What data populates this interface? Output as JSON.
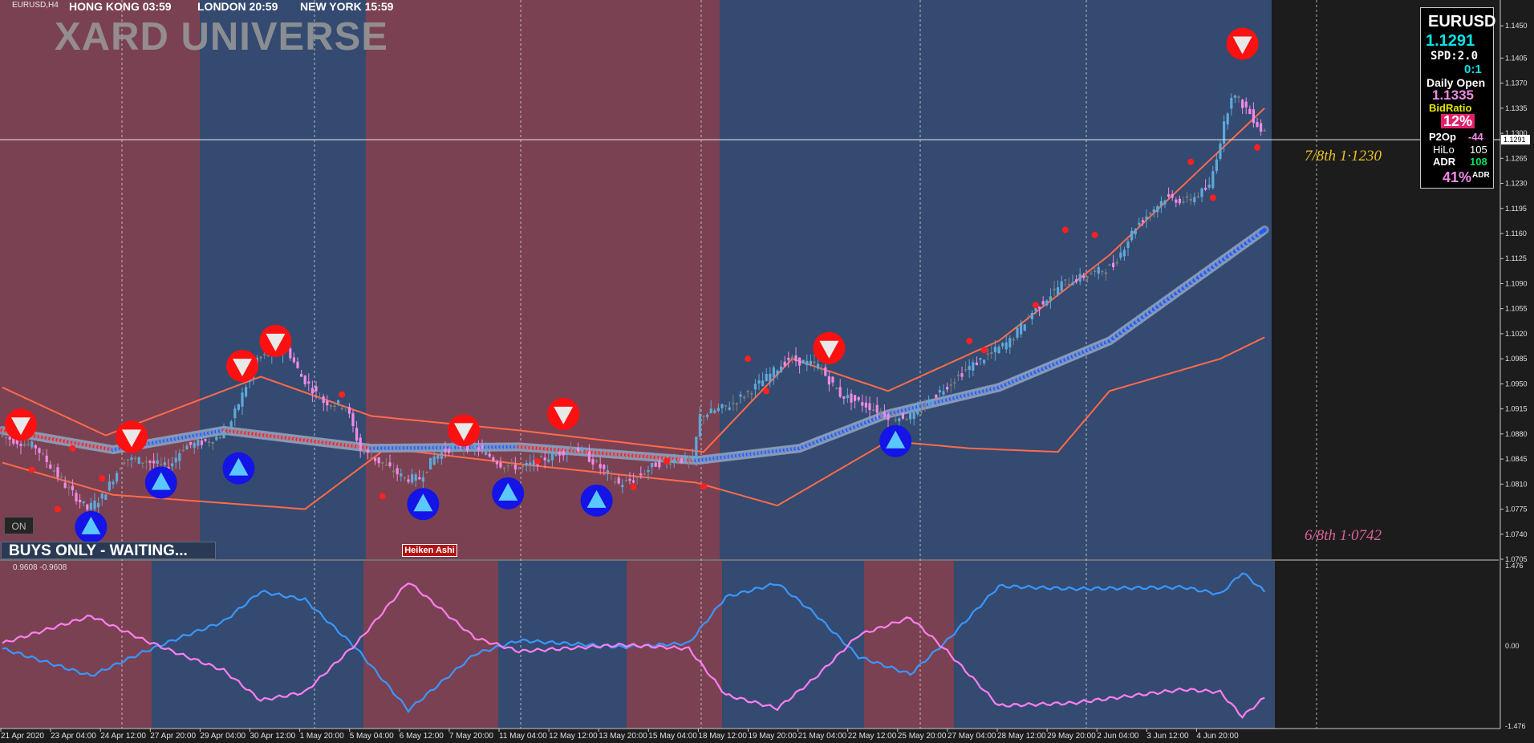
{
  "symbol_title": "EURUSD,H4",
  "logo_text": "XARD UNIVERSE",
  "sessions": [
    {
      "label": "HONG KONG 03:59",
      "color": "#9e1a1a"
    },
    {
      "label": "LONDON 20:59",
      "color": "#9e1a1a"
    },
    {
      "label": "NEW YORK 15:59",
      "color": "#1f6fd6"
    }
  ],
  "info_panel": {
    "symbol": "EURUSD",
    "price": "1.1291",
    "spread": "SPD:2.0",
    "ratio": "0:1",
    "daily_open_label": "Daily Open",
    "daily_open": "1.1335",
    "bid_ratio_label": "BidRatio",
    "bid_ratio": "12%",
    "p2op_label": "P2Op",
    "p2op": "-44",
    "hilo_label": "HiLo",
    "hilo": "105",
    "adr_label": "ADR",
    "adr": "108",
    "adr_pct": "41%",
    "adr_pct_label": "ADR"
  },
  "levels": [
    {
      "label": "7/8th  1·1230",
      "color": "#e6c020"
    },
    {
      "label": "6/8th  1·0742",
      "color": "#e0609a"
    }
  ],
  "buttons": {
    "on_label": "ON",
    "heiken_label": "Heiken Ashi"
  },
  "status_text": "BUYS ONLY - WAITING...",
  "oscillator_label": "0.9608 -0.9608",
  "colors": {
    "bg": "#1c1c1c",
    "red_zone": "#7a4152",
    "blue_zone": "#344a70",
    "bull_candle": "#5fa8d8",
    "bear_candle": "#f08ae6",
    "neutral_candle": "#808080",
    "fast_ma_blue": "#1e5bff",
    "fast_ma_red": "#ff1a1a",
    "envelope": "#ff6a4a",
    "osc_blue": "#3a96ff",
    "osc_pink": "#ff7ef0"
  },
  "chart_data": [
    {
      "type": "candlestick",
      "symbol": "EURUSD",
      "timeframe": "H4",
      "current_price": 1.1291,
      "ylim": [
        1.0705,
        1.1485
      ],
      "y_ticks": [
        "1.1450",
        "1.1405",
        "1.1370",
        "1.1335",
        "1.1300",
        "1.1265",
        "1.1230",
        "1.1195",
        "1.1160",
        "1.1125",
        "1.1090",
        "1.1055",
        "1.1020",
        "1.0985",
        "1.0950",
        "1.0915",
        "1.0880",
        "1.0845",
        "1.0810",
        "1.0775",
        "1.0740",
        "1.0705"
      ],
      "x_ticks": [
        "21 Apr 2020",
        "23 Apr 04:00",
        "24 Apr 12:00",
        "27 Apr 20:00",
        "29 Apr 04:00",
        "30 Apr 12:00",
        "1 May 20:00",
        "5 May 04:00",
        "6 May 12:00",
        "7 May 20:00",
        "11 May 04:00",
        "12 May 12:00",
        "13 May 20:00",
        "15 May 04:00",
        "18 May 12:00",
        "19 May 20:00",
        "21 May 04:00",
        "22 May 12:00",
        "25 May 20:00",
        "27 May 04:00",
        "28 May 12:00",
        "29 May 20:00",
        "2 Jun 04:00",
        "3 Jun 12:00",
        "4 Jun 20:00"
      ],
      "price_path": [
        [
          0,
          1.0878
        ],
        [
          10,
          1.0862
        ],
        [
          18,
          1.0808
        ],
        [
          24,
          1.0775
        ],
        [
          28,
          1.0792
        ],
        [
          34,
          1.0845
        ],
        [
          40,
          1.0842
        ],
        [
          46,
          1.0833
        ],
        [
          50,
          1.0862
        ],
        [
          58,
          1.0872
        ],
        [
          62,
          1.0885
        ],
        [
          70,
          1.0985
        ],
        [
          78,
          1.1
        ],
        [
          82,
          1.096
        ],
        [
          88,
          1.0925
        ],
        [
          94,
          1.092
        ],
        [
          98,
          1.0858
        ],
        [
          104,
          1.0838
        ],
        [
          110,
          1.0818
        ],
        [
          114,
          1.0818
        ],
        [
          118,
          1.0848
        ],
        [
          124,
          1.0865
        ],
        [
          130,
          1.086
        ],
        [
          136,
          1.0838
        ],
        [
          142,
          1.0833
        ],
        [
          150,
          1.085
        ],
        [
          156,
          1.0862
        ],
        [
          162,
          1.0838
        ],
        [
          168,
          1.081
        ],
        [
          172,
          1.0816
        ],
        [
          178,
          1.0838
        ],
        [
          184,
          1.0845
        ],
        [
          188,
          1.0843
        ],
        [
          190,
          1.0905
        ],
        [
          198,
          1.092
        ],
        [
          206,
          1.095
        ],
        [
          214,
          1.0985
        ],
        [
          222,
          1.0975
        ],
        [
          228,
          1.0935
        ],
        [
          236,
          1.0918
        ],
        [
          242,
          1.0903
        ],
        [
          248,
          1.0905
        ],
        [
          254,
          1.0935
        ],
        [
          262,
          1.097
        ],
        [
          268,
          1.099
        ],
        [
          274,
          1.101
        ],
        [
          280,
          1.105
        ],
        [
          288,
          1.109
        ],
        [
          294,
          1.11
        ],
        [
          302,
          1.1115
        ],
        [
          308,
          1.117
        ],
        [
          316,
          1.121
        ],
        [
          322,
          1.1205
        ],
        [
          328,
          1.1225
        ],
        [
          334,
          1.1355
        ],
        [
          338,
          1.1335
        ],
        [
          342,
          1.1305
        ]
      ],
      "bands": [
        {
          "name": "",
          "points": [
            [
              0,
              1.0885
            ],
            [
              30,
              1.0858
            ],
            [
              60,
              1.0885
            ],
            [
              100,
              1.086
            ],
            [
              140,
              1.0862
            ],
            [
              188,
              1.0843
            ],
            [
              216,
              1.086
            ],
            [
              240,
              1.0908
            ],
            [
              270,
              1.0945
            ],
            [
              300,
              1.101
            ],
            [
              342,
              1.1165
            ]
          ]
        },
        {
          "name": "",
          "points": [
            [
              0,
              1.0945
            ],
            [
              28,
              1.0878
            ],
            [
              70,
              1.096
            ],
            [
              100,
              1.0905
            ],
            [
              140,
              1.0885
            ],
            [
              190,
              1.0855
            ],
            [
              214,
              1.0985
            ],
            [
              240,
              1.094
            ],
            [
              270,
              1.101
            ],
            [
              300,
              1.113
            ],
            [
              342,
              1.1335
            ]
          ]
        },
        {
          "name": "",
          "points": [
            [
              0,
              1.084
            ],
            [
              30,
              1.0795
            ],
            [
              82,
              1.0775
            ],
            [
              104,
              1.086
            ],
            [
              140,
              1.0838
            ],
            [
              188,
              1.0812
            ],
            [
              210,
              1.078
            ],
            [
              240,
              1.087
            ],
            [
              262,
              1.086
            ],
            [
              286,
              1.0855
            ],
            [
              300,
              1.094
            ],
            [
              330,
              1.0985
            ],
            [
              342,
              1.1015
            ]
          ]
        }
      ]
    },
    {
      "type": "line",
      "title": "0.9608 -0.9608",
      "ylim": [
        -1.476,
        1.476
      ],
      "y_ticks": [
        "1.476",
        "0.00",
        "-1.476"
      ],
      "series": [
        {
          "points": [
            [
              0,
              -0.05
            ],
            [
              24,
              -0.55
            ],
            [
              38,
              -0.12
            ],
            [
              48,
              0.15
            ],
            [
              60,
              0.45
            ],
            [
              70,
              1.0
            ],
            [
              82,
              0.85
            ],
            [
              96,
              -0.05
            ],
            [
              110,
              -1.18
            ],
            [
              128,
              -0.15
            ],
            [
              140,
              0.1
            ],
            [
              168,
              -0.02
            ],
            [
              186,
              0.05
            ],
            [
              196,
              0.9
            ],
            [
              210,
              1.15
            ],
            [
              220,
              0.6
            ],
            [
              232,
              -0.2
            ],
            [
              246,
              -0.52
            ],
            [
              256,
              0.1
            ],
            [
              270,
              1.1
            ],
            [
              290,
              1.05
            ],
            [
              320,
              1.08
            ],
            [
              330,
              0.95
            ],
            [
              336,
              1.35
            ],
            [
              342,
              1.0
            ]
          ]
        },
        {
          "points": [
            [
              0,
              0.05
            ],
            [
              24,
              0.55
            ],
            [
              38,
              0.12
            ],
            [
              48,
              -0.15
            ],
            [
              60,
              -0.45
            ],
            [
              70,
              -1.0
            ],
            [
              82,
              -0.85
            ],
            [
              96,
              0.05
            ],
            [
              110,
              1.18
            ],
            [
              128,
              0.15
            ],
            [
              140,
              -0.1
            ],
            [
              168,
              0.02
            ],
            [
              186,
              -0.05
            ],
            [
              196,
              -0.9
            ],
            [
              210,
              -1.15
            ],
            [
              220,
              -0.6
            ],
            [
              232,
              0.2
            ],
            [
              246,
              0.52
            ],
            [
              256,
              -0.1
            ],
            [
              270,
              -1.1
            ],
            [
              290,
              -1.05
            ],
            [
              320,
              -0.8
            ],
            [
              330,
              -0.85
            ],
            [
              336,
              -1.3
            ],
            [
              342,
              -0.95
            ]
          ]
        }
      ]
    }
  ]
}
